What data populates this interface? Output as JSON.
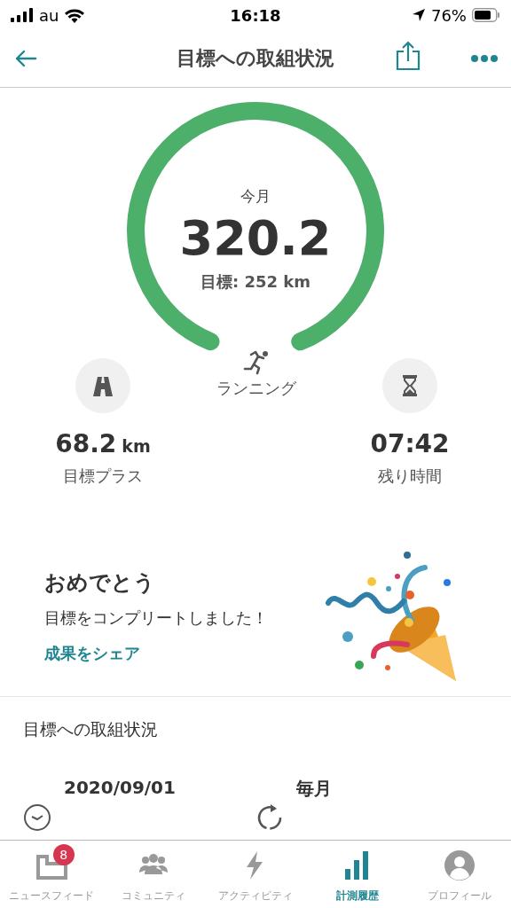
{
  "status_bar": {
    "carrier": "au",
    "time": "16:18",
    "battery": "76%"
  },
  "header": {
    "title": "目標への取組状況"
  },
  "goal": {
    "period": "今月",
    "value": "320.2",
    "target": "目標: 252 km",
    "level": 1,
    "activity": "ランニング"
  },
  "stats": [
    {
      "kind": "road",
      "value": "68.2",
      "unit": "km",
      "label": "目標プラス"
    },
    {
      "kind": "hourglass",
      "value": "07:42",
      "label": "残り時間"
    }
  ],
  "congrats": {
    "title": "おめでとう",
    "message": "目標をコンプリートしました！",
    "link": "成果をシェア"
  },
  "section": {
    "title": "目標への取組状況",
    "details": [
      {
        "kind": "clock",
        "value": "2020/09/01"
      },
      {
        "kind": "repeat",
        "value": "毎月"
      }
    ]
  },
  "tabs": [
    {
      "kind": "news",
      "label": "ニュースフィード",
      "selected": false,
      "badge": "8"
    },
    {
      "kind": "community",
      "label": "コミュニティ",
      "selected": false
    },
    {
      "kind": "activity",
      "label": "アクティビティ",
      "selected": false
    },
    {
      "kind": "history",
      "label": "計測履歴",
      "selected": true
    },
    {
      "kind": "profile",
      "label": "プロフィール",
      "selected": false
    }
  ]
}
